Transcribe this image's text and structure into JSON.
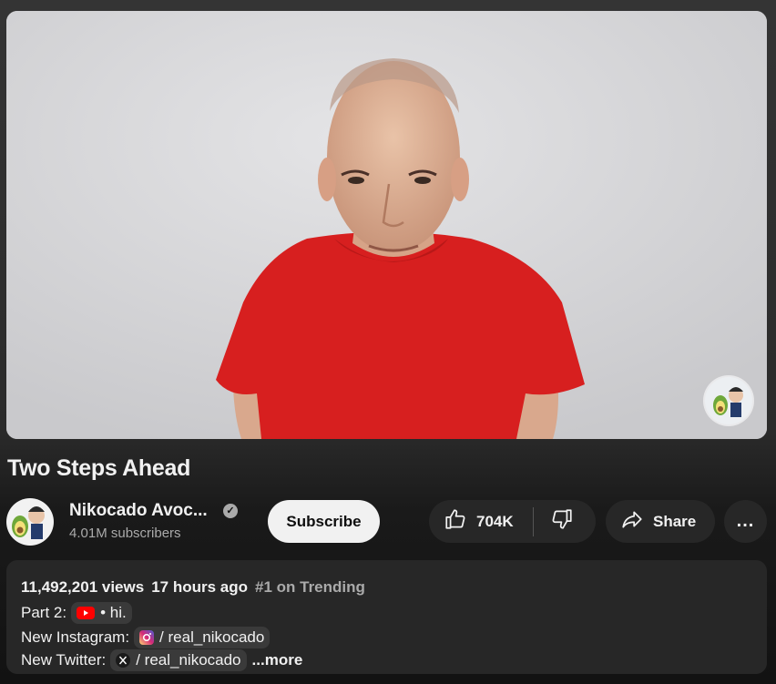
{
  "video": {
    "title": "Two Steps Ahead"
  },
  "channel": {
    "name": "Nikocado Avoc...",
    "subscribers": "4.01M subscribers",
    "avatar_icon": "avocado-avatar-icon",
    "verified_icon": "verified-check-icon"
  },
  "actions": {
    "subscribe_label": "Subscribe",
    "like_count": "704K",
    "share_label": "Share",
    "more_label": "..."
  },
  "description": {
    "views": "11,492,201 views",
    "age": "17 hours ago",
    "trending": "#1 on Trending",
    "part2_label": "Part 2:",
    "part2_link": "• hi.",
    "instagram_label": "New Instagram:",
    "instagram_link": "/ real_nikocado",
    "twitter_label": "New Twitter:",
    "twitter_link": "/ real_nikocado",
    "more_label": "...more"
  },
  "colors": {
    "background": "#0f0f0f",
    "button_bg": "#272727",
    "subscribe_bg": "#f1f1f1",
    "secondary_text": "#aaaaaa",
    "youtube_red": "#ff0000",
    "shirt_red": "#d71f1f"
  }
}
